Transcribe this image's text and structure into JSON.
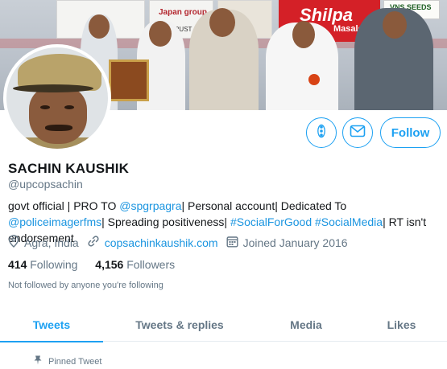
{
  "banner": {
    "shilpa_brand": "Shilpa",
    "shilpa_sub": "Masale",
    "board_text": "Japan group",
    "board_sub": "of TRUST",
    "vns_text": "VNS SEEDS"
  },
  "actions": {
    "more_icon": "more-vertical-icon",
    "message_icon": "envelope-icon",
    "follow_label": "Follow"
  },
  "profile": {
    "name": "SACHIN KAUSHIK",
    "handle": "@upcopsachin",
    "bio": {
      "p1": "govt official | PRO TO ",
      "link1": "@spgrpagra",
      "p2": "| Personal account| Dedicated To ",
      "link2": "@policeimagerfms",
      "p3": "| Spreading positiveness| ",
      "link3": "#SocialForGood",
      "p4": " ",
      "link4": "#SocialMedia",
      "p5": "| RT isn't endorsement"
    },
    "location": "Agra, India",
    "website": "copsachinkaushik.com",
    "joined": "Joined January 2016",
    "following_count": "414",
    "following_label": "Following",
    "followers_count": "4,156",
    "followers_label": "Followers",
    "not_followed": "Not followed by anyone you're following"
  },
  "tabs": [
    {
      "label": "Tweets",
      "active": true
    },
    {
      "label": "Tweets & replies"
    },
    {
      "label": "Media"
    },
    {
      "label": "Likes"
    }
  ],
  "pinned_label": "Pinned Tweet",
  "colors": {
    "accent": "#1da1f2",
    "link": "#1b95e0",
    "secondary_text": "#657786"
  }
}
